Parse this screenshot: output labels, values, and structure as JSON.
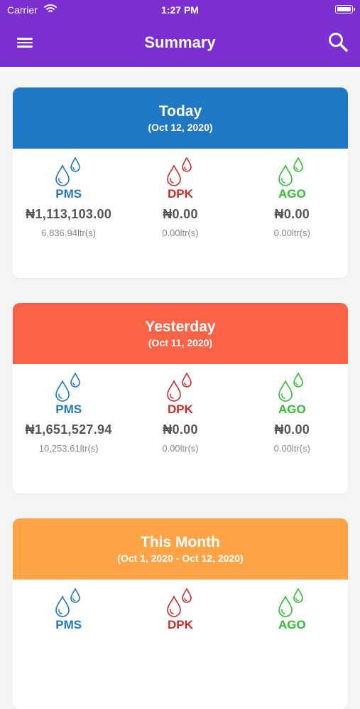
{
  "status": {
    "carrier": "Carrier",
    "time": "1:27 PM"
  },
  "appbar": {
    "title": "Summary"
  },
  "colors": {
    "appbar": "#7b2fd0",
    "pms": "#1f78c3",
    "dpk": "#cc2b2b",
    "ago": "#2fbf2f",
    "today": "#1f78c3",
    "yesterday": "#fb6346",
    "month": "#fea446"
  },
  "icons": {
    "menu": "hamburger-menu-icon",
    "search": "search-icon",
    "fuel": "fuel-drops-icon"
  },
  "cards": [
    {
      "title": "Today",
      "date": "(Oct 12, 2020)",
      "items": [
        {
          "fuel": "PMS",
          "amount": "₦1,113,103.00",
          "litres": "6,836.94ltr(s)"
        },
        {
          "fuel": "DPK",
          "amount": "₦0.00",
          "litres": "0.00ltr(s)"
        },
        {
          "fuel": "AGO",
          "amount": "₦0.00",
          "litres": "0.00ltr(s)"
        }
      ]
    },
    {
      "title": "Yesterday",
      "date": "(Oct 11, 2020)",
      "items": [
        {
          "fuel": "PMS",
          "amount": "₦1,651,527.94",
          "litres": "10,253.61ltr(s)"
        },
        {
          "fuel": "DPK",
          "amount": "₦0.00",
          "litres": "0.00ltr(s)"
        },
        {
          "fuel": "AGO",
          "amount": "₦0.00",
          "litres": "0.00ltr(s)"
        }
      ]
    },
    {
      "title": "This Month",
      "date": "(Oct 1, 2020 - Oct 12, 2020)",
      "items": [
        {
          "fuel": "PMS"
        },
        {
          "fuel": "DPK"
        },
        {
          "fuel": "AGO"
        }
      ]
    }
  ]
}
